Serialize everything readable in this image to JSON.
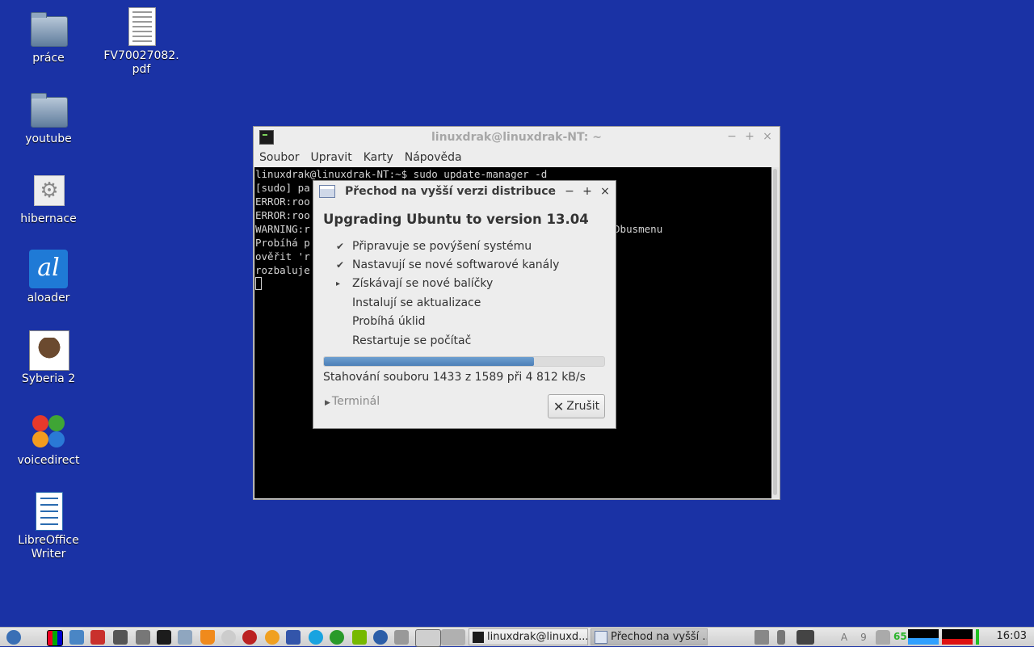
{
  "desktop": {
    "icons": [
      {
        "label": "práce"
      },
      {
        "label": "FV70027082.pdf"
      },
      {
        "label": "youtube"
      },
      {
        "label": "hibernace"
      },
      {
        "label": "aloader",
        "glyph": "al"
      },
      {
        "label": "Syberia 2"
      },
      {
        "label": "voicedirect"
      },
      {
        "label": "LibreOffice Writer"
      }
    ]
  },
  "terminal": {
    "title": "linuxdrak@linuxdrak-NT: ~",
    "menu": [
      "Soubor",
      "Upravit",
      "Karty",
      "Nápověda"
    ],
    "lines": [
      "linuxdrak@linuxdrak-NT:~$ sudo update-manager -d",
      "[sudo] pa",
      "ERROR:roo",
      "ERROR:roo",
      "WARNING:r                                                  Dbusmenu",
      "Probíhá p",
      "ověřit 'r",
      "rozbaluje"
    ],
    "window_buttons": [
      "−",
      "+",
      "×"
    ]
  },
  "dialog": {
    "title": "Přechod na vyšší verzi distribuce",
    "heading": "Upgrading Ubuntu to version 13.04",
    "steps": [
      {
        "label": "Připravuje se povýšení systému",
        "state": "done",
        "mark": "✔"
      },
      {
        "label": "Nastavují se nové softwarové kanály",
        "state": "done",
        "mark": "✔"
      },
      {
        "label": "Získávají se nové balíčky",
        "state": "current",
        "mark": "▸"
      },
      {
        "label": "Instalují se aktualizace",
        "state": "pending",
        "mark": ""
      },
      {
        "label": "Probíhá úklid",
        "state": "pending",
        "mark": ""
      },
      {
        "label": "Restartuje se počítač",
        "state": "pending",
        "mark": ""
      }
    ],
    "progress_fraction": 0.75,
    "status": "Stahování souboru 1433 z 1589 při 4 812 kB/s",
    "expander_label": "Terminál",
    "cancel_label": "Zrušit",
    "window_buttons": [
      "−",
      "+",
      "×"
    ]
  },
  "taskbar": {
    "tasks": [
      {
        "label": "linuxdrak@linuxd..."
      },
      {
        "label": "Přechod na vyšší ..."
      }
    ],
    "cpu_percent": "65",
    "clock": "16:03",
    "indicators": [
      "A",
      "9"
    ]
  },
  "colors": {
    "desktop_bg": "#1a32a5",
    "progress": "#5b8cc4",
    "cpu_text": "#2bb52b"
  }
}
